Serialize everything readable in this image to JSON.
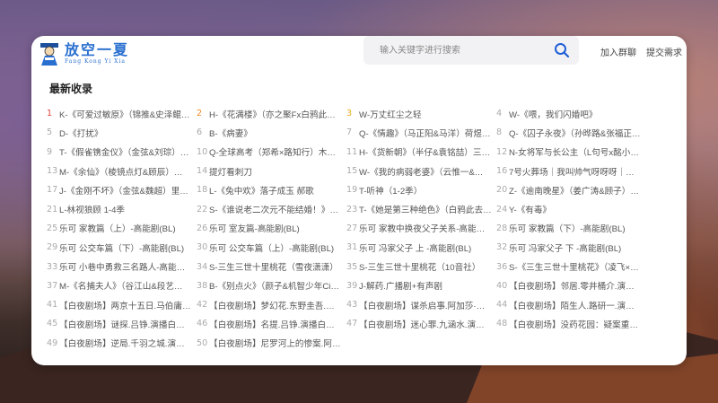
{
  "logo": {
    "title": "放空一夏",
    "pinyin": "Fang Kong Yi Xia"
  },
  "search": {
    "placeholder": "输入关键字进行搜索",
    "value": ""
  },
  "nav": {
    "join": "加入群聊",
    "submit": "提交需求"
  },
  "section": {
    "title": "最新收录"
  },
  "colors": {
    "rank1": "#e0443a",
    "rank2": "#f08a24",
    "rank3": "#e6ad1c",
    "rank_default": "#aaaaaa",
    "accent": "#1f5fd6"
  },
  "items": [
    {
      "rank": "1",
      "title": "K-《可爱过敏原》（锦推&史泽鲲…"
    },
    {
      "rank": "2",
      "title": "H-《花满楼》（亦之聚Fx白鸦此去）"
    },
    {
      "rank": "3",
      "title": "W-万丈红尘之轻"
    },
    {
      "rank": "4",
      "title": "W-《喂，我们闪婚吧》"
    },
    {
      "rank": "5",
      "title": "D-《打扰》"
    },
    {
      "rank": "6",
      "title": "B-《病妻》"
    },
    {
      "rank": "7",
      "title": "Q-《情趣》（马正阳&马洋）荷煜…"
    },
    {
      "rank": "8",
      "title": "Q-《囚子永夜》（孙晔路&张福正…"
    },
    {
      "rank": "9",
      "title": "T-《假雀镌金仪》（金弦&刘琮）…"
    },
    {
      "rank": "10",
      "title": "Q-全球高考（郑希×路知行）木苏…"
    },
    {
      "rank": "11",
      "title": "H-《货新朝》（半仔&袁铭喆）三…"
    },
    {
      "rank": "12",
      "title": "N-女将军与长公主（L句号x酩小酩…"
    },
    {
      "rank": "13",
      "title": "M-《余仙》（棱镜点灯&顾辰）…"
    },
    {
      "rank": "14",
      "title": "提灯看刺刀"
    },
    {
      "rank": "15",
      "title": "W-《我的病弱老婆》（云惟一&…"
    },
    {
      "rank": "16",
      "title": "7号火葬场｜我叫帅气呀呀呀｜仓…"
    },
    {
      "rank": "17",
      "title": "J-《金刚不坏》（金弦&魏超）里…"
    },
    {
      "rank": "18",
      "title": "L-《兔中欢》落子成玉 郝歌"
    },
    {
      "rank": "19",
      "title": "T-听神（1-2季）"
    },
    {
      "rank": "20",
      "title": "Z-《逾南晚星》（姜广涛&顾子）…"
    },
    {
      "rank": "21",
      "title": "L-林视狼顾 1-4季"
    },
    {
      "rank": "22",
      "title": "S-《谁说老二次元不能结婚！》（…"
    },
    {
      "rank": "23",
      "title": "T-《她是第三种绝色》（白鸦此去…"
    },
    {
      "rank": "24",
      "title": "Y-《有毒》"
    },
    {
      "rank": "25",
      "title": "乐可 家教篇（上）-高能剧(BL)"
    },
    {
      "rank": "26",
      "title": "乐可 室友篇-高能剧(BL)"
    },
    {
      "rank": "27",
      "title": "乐可 家教中换夜父子关系-高能剧(…"
    },
    {
      "rank": "28",
      "title": "乐可 家教篇（下）-高能剧(BL)"
    },
    {
      "rank": "29",
      "title": "乐可 公交车篇（下）-高能剧(BL)"
    },
    {
      "rank": "30",
      "title": "乐可 公交车篇（上）-高能剧(BL)"
    },
    {
      "rank": "31",
      "title": "乐可 冯家父子 上 -高能剧(BL)"
    },
    {
      "rank": "32",
      "title": "乐可 冯家父子 下 -高能剧(BL)"
    },
    {
      "rank": "33",
      "title": "乐可 小巷中勇救三名路人-高能剧(…"
    },
    {
      "rank": "34",
      "title": "S-三生三世十里桃花（雪夜潇潇）"
    },
    {
      "rank": "35",
      "title": "S-三生三世十里桃花（10音社）"
    },
    {
      "rank": "36",
      "title": "S-《三生三世十里桃花》（凌飞×…"
    },
    {
      "rank": "37",
      "title": "M-《名捕夫人》（谷江山&段艺…"
    },
    {
      "rank": "38",
      "title": "B-《别点火》（颜子&机智少年Ci…"
    },
    {
      "rank": "39",
      "title": "J-解药.广播剧+有声剧"
    },
    {
      "rank": "40",
      "title": "【白夜剧场】邻居.零井桶介.演播…"
    },
    {
      "rank": "41",
      "title": "【白夜剧场】两京十五日.马伯庸…"
    },
    {
      "rank": "42",
      "title": "【白夜剧场】梦幻花.东野圭吾.演…"
    },
    {
      "rank": "43",
      "title": "【白夜剧场】谋杀启事.阿加莎·克…"
    },
    {
      "rank": "44",
      "title": "【白夜剧场】陌生人.路研一.演播…"
    },
    {
      "rank": "45",
      "title": "【白夜剧场】谜探.吕铮.演播白夜…"
    },
    {
      "rank": "46",
      "title": "【白夜剧场】名提.吕铮.演播白夜…"
    },
    {
      "rank": "47",
      "title": "【白夜剧场】迷心罪.九涵水.演播…"
    },
    {
      "rank": "48",
      "title": "【白夜剧场】没药花园：疑案重现…"
    },
    {
      "rank": "49",
      "title": "【白夜剧场】逆局.千羽之城.演播…"
    },
    {
      "rank": "50",
      "title": "【白夜剧场】尼罗河上的惨案.阿加…"
    }
  ]
}
